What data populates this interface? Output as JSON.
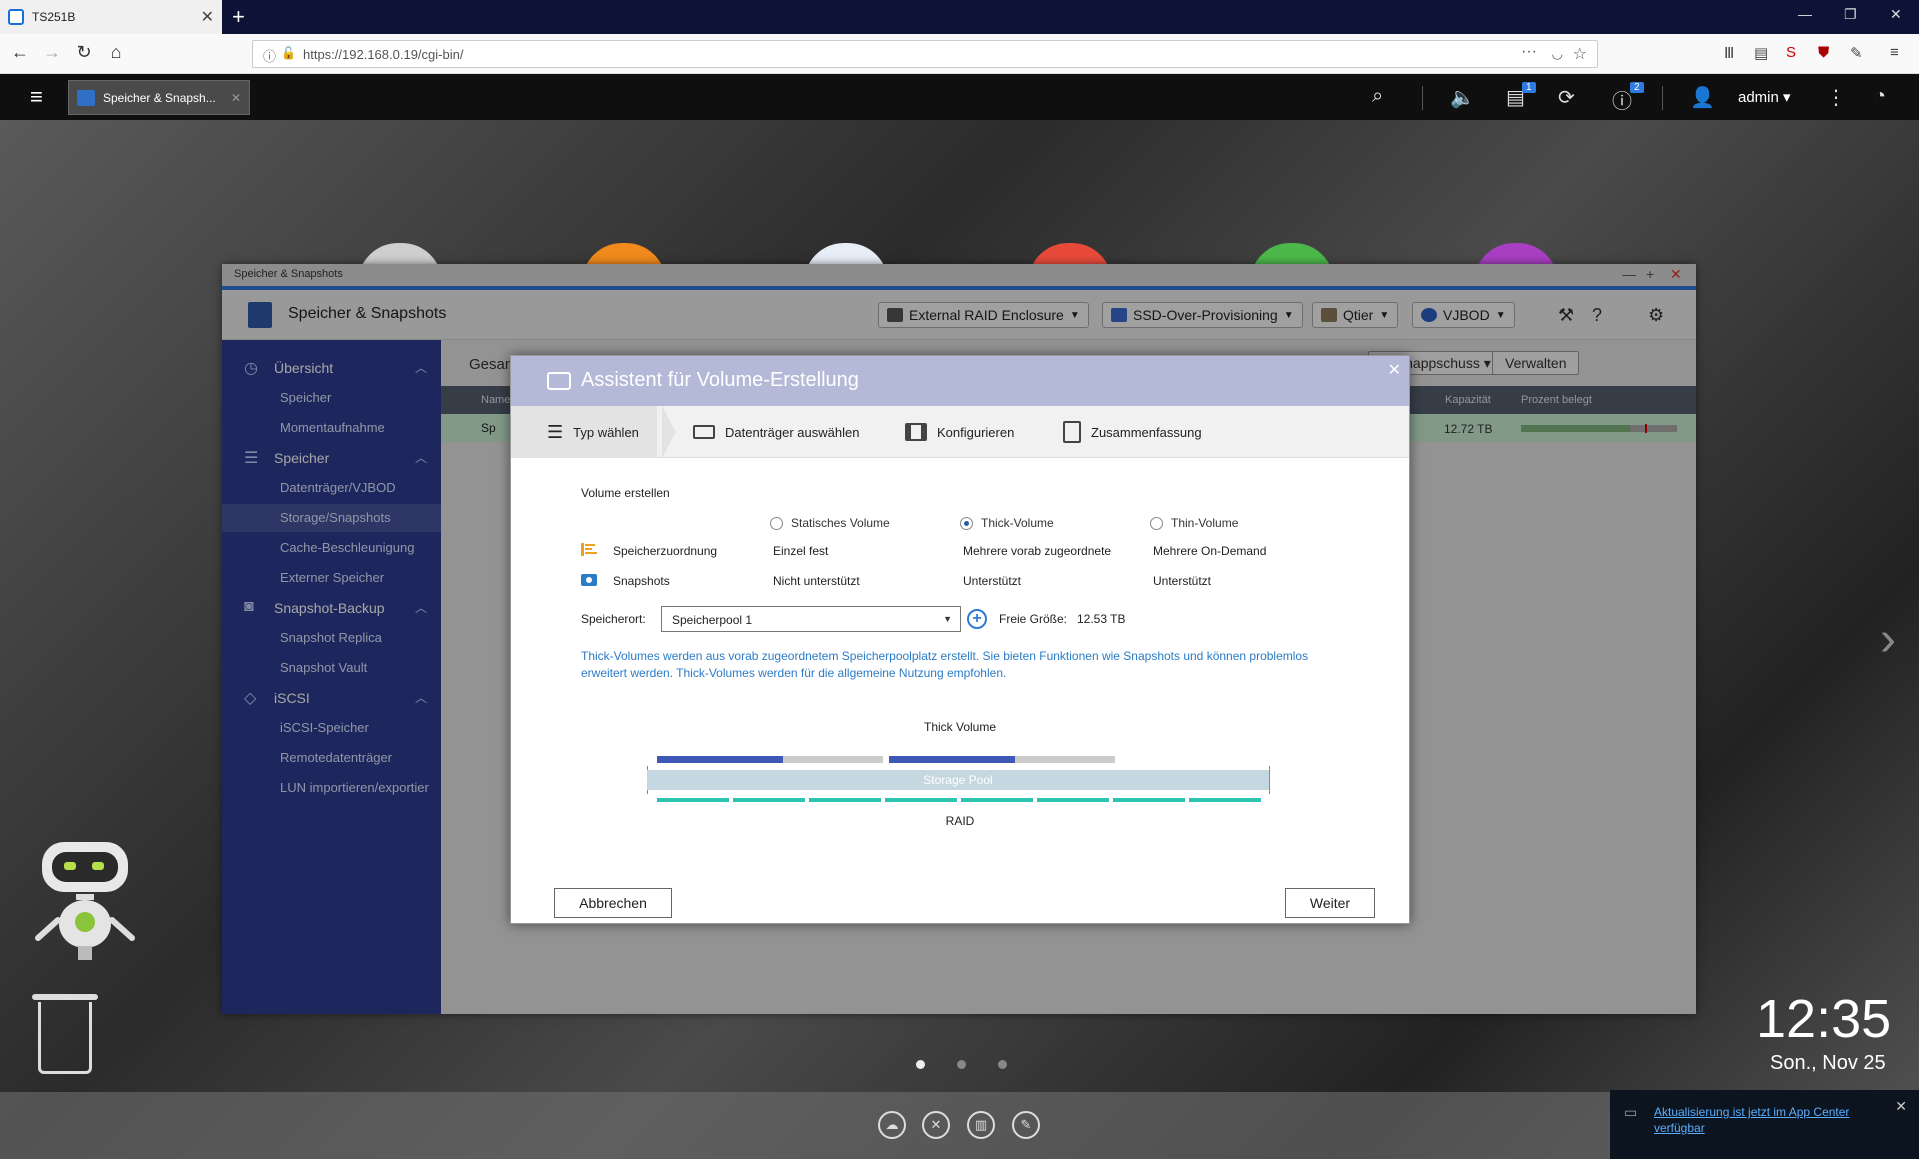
{
  "browser": {
    "tab_title": "TS251B",
    "new_tab": "+",
    "url": "https://192.168.0.19/cgi-bin/",
    "window_controls": [
      "—",
      "❐",
      "✕"
    ]
  },
  "qnap_bar": {
    "app_tab_label": "Speicher & Snapsh...",
    "user": "admin ▾",
    "badge_tasks": "1",
    "badge_info": "2"
  },
  "app": {
    "window_title": "Speicher & Snapshots",
    "header_title": "Speicher & Snapshots",
    "header_buttons": [
      "External RAID Enclosure",
      "SSD-Over-Provisioning",
      "Qtier",
      "VJBOD"
    ],
    "sidebar": [
      {
        "label": "Übersicht",
        "items": [
          "Speicher",
          "Momentaufnahme"
        ]
      },
      {
        "label": "Speicher",
        "items": [
          "Datenträger/VJBOD",
          "Storage/Snapshots",
          "Cache-Beschleunigung",
          "Externer Speicher"
        ]
      },
      {
        "label": "Snapshot-Backup",
        "items": [
          "Snapshot Replica",
          "Snapshot Vault"
        ]
      },
      {
        "label": "iSCSI",
        "items": [
          "iSCSI-Speicher",
          "Remotedatenträger",
          "LUN importieren/exportier"
        ]
      }
    ],
    "content": {
      "title": "Gesan",
      "btn_snapshot": "Schnappschuss ▾",
      "btn_manage": "Verwalten",
      "columns": {
        "name": "Name",
        "capacity": "Kapazität",
        "percent": "Prozent belegt"
      },
      "row": {
        "name": "Sp",
        "capacity": "12.72 TB",
        "used_fraction": 0.7
      }
    }
  },
  "dialog": {
    "title": "Assistent für Volume-Erstellung",
    "steps": [
      "Typ wählen",
      "Datenträger auswählen",
      "Konfigurieren",
      "Zusammenfassung"
    ],
    "section_label": "Volume erstellen",
    "volume_types": [
      {
        "label": "Statisches Volume",
        "selected": false,
        "allocation": "Einzel fest",
        "snapshots": "Nicht unterstützt"
      },
      {
        "label": "Thick-Volume",
        "selected": true,
        "allocation": "Mehrere vorab zugeordnete",
        "snapshots": "Unterstützt"
      },
      {
        "label": "Thin-Volume",
        "selected": false,
        "allocation": "Mehrere On-Demand",
        "snapshots": "Unterstützt"
      }
    ],
    "row_allocation_label": "Speicherzuordnung",
    "row_snapshots_label": "Snapshots",
    "location_label": "Speicherort:",
    "location_value": "Speicherpool 1",
    "free_size_label": "Freie Größe:",
    "free_size_value": "12.53 TB",
    "description": "Thick-Volumes werden aus vorab zugeordnetem Speicherpoolplatz erstellt. Sie bieten Funktionen wie Snapshots und können problemlos erweitert werden. Thick-Volumes werden für die allgemeine Nutzung empfohlen.",
    "diagram_title": "Thick Volume",
    "pool_label": "Storage Pool",
    "raid_label": "RAID",
    "cancel": "Abbrechen",
    "next": "Weiter"
  },
  "desktop": {
    "time": "12:35",
    "date": "Son., Nov 25",
    "notification": "Aktualisierung ist jetzt im App Center verfügbar"
  }
}
